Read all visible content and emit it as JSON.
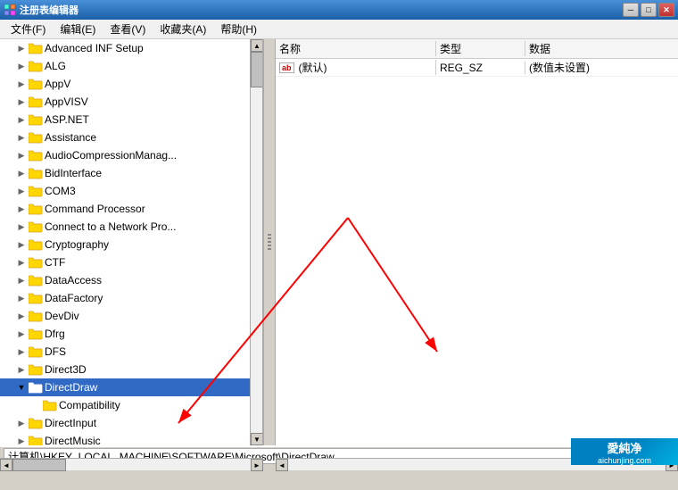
{
  "window": {
    "title": "注册表编辑器",
    "menu": [
      "文件(F)",
      "编辑(E)",
      "查看(V)",
      "收藏夹(A)",
      "帮助(H)"
    ]
  },
  "tree": {
    "items": [
      {
        "label": "Advanced INF Setup",
        "indent": 2,
        "hasExpander": true,
        "expanded": false,
        "selected": false
      },
      {
        "label": "ALG",
        "indent": 2,
        "hasExpander": true,
        "expanded": false,
        "selected": false
      },
      {
        "label": "AppV",
        "indent": 2,
        "hasExpander": true,
        "expanded": false,
        "selected": false
      },
      {
        "label": "AppVISV",
        "indent": 2,
        "hasExpander": true,
        "expanded": false,
        "selected": false
      },
      {
        "label": "ASP.NET",
        "indent": 2,
        "hasExpander": true,
        "expanded": false,
        "selected": false
      },
      {
        "label": "Assistance",
        "indent": 2,
        "hasExpander": true,
        "expanded": false,
        "selected": false
      },
      {
        "label": "AudioCompressionManag...",
        "indent": 2,
        "hasExpander": true,
        "expanded": false,
        "selected": false
      },
      {
        "label": "BidInterface",
        "indent": 2,
        "hasExpander": true,
        "expanded": false,
        "selected": false
      },
      {
        "label": "COM3",
        "indent": 2,
        "hasExpander": true,
        "expanded": false,
        "selected": false
      },
      {
        "label": "Command Processor",
        "indent": 2,
        "hasExpander": true,
        "expanded": false,
        "selected": false
      },
      {
        "label": "Connect to a Network Pro...",
        "indent": 2,
        "hasExpander": true,
        "expanded": false,
        "selected": false
      },
      {
        "label": "Cryptography",
        "indent": 2,
        "hasExpander": true,
        "expanded": false,
        "selected": false
      },
      {
        "label": "CTF",
        "indent": 2,
        "hasExpander": true,
        "expanded": false,
        "selected": false
      },
      {
        "label": "DataAccess",
        "indent": 2,
        "hasExpander": true,
        "expanded": false,
        "selected": false
      },
      {
        "label": "DataFactory",
        "indent": 2,
        "hasExpander": true,
        "expanded": false,
        "selected": false
      },
      {
        "label": "DevDiv",
        "indent": 2,
        "hasExpander": true,
        "expanded": false,
        "selected": false
      },
      {
        "label": "Dfrg",
        "indent": 2,
        "hasExpander": true,
        "expanded": false,
        "selected": false
      },
      {
        "label": "DFS",
        "indent": 2,
        "hasExpander": true,
        "expanded": false,
        "selected": false
      },
      {
        "label": "Direct3D",
        "indent": 2,
        "hasExpander": true,
        "expanded": false,
        "selected": false
      },
      {
        "label": "DirectDraw",
        "indent": 2,
        "hasExpander": true,
        "expanded": true,
        "selected": true
      },
      {
        "label": "Compatibility",
        "indent": 3,
        "hasExpander": false,
        "expanded": false,
        "selected": false,
        "isChild": true
      },
      {
        "label": "DirectInput",
        "indent": 2,
        "hasExpander": true,
        "expanded": false,
        "selected": false
      },
      {
        "label": "DirectMusic",
        "indent": 2,
        "hasExpander": true,
        "expanded": false,
        "selected": false
      }
    ]
  },
  "table": {
    "headers": [
      "名称",
      "类型",
      "数据"
    ],
    "rows": [
      {
        "name": "(默认)",
        "type": "REG_SZ",
        "data": "(数值未设置)",
        "isDefault": true
      }
    ]
  },
  "statusbar": {
    "path": "计算机\\HKEY_LOCAL_MACHINE\\SOFTWARE\\Microsoft\\DirectDraw"
  },
  "watermark": {
    "line1": "愛純净",
    "line2": "aichunjing.com"
  }
}
